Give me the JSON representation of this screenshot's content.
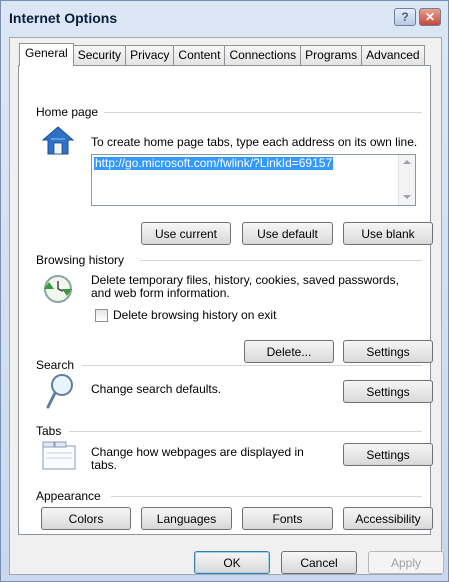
{
  "window": {
    "title": "Internet Options"
  },
  "tabs": [
    "General",
    "Security",
    "Privacy",
    "Content",
    "Connections",
    "Programs",
    "Advanced"
  ],
  "home_page": {
    "label": "Home page",
    "description": "To create home page tabs, type each address on its own line.",
    "url": "http://go.microsoft.com/fwlink/?LinkId=69157",
    "buttons": {
      "use_current": "Use current",
      "use_default": "Use default",
      "use_blank": "Use blank"
    }
  },
  "browsing_history": {
    "label": "Browsing history",
    "description_line1": "Delete temporary files, history, cookies, saved passwords,",
    "description_line2": "and web form information.",
    "checkbox_label": "Delete browsing history on exit",
    "checkbox_checked": false,
    "buttons": {
      "delete": "Delete...",
      "settings": "Settings"
    }
  },
  "search": {
    "label": "Search",
    "description": "Change search defaults.",
    "settings": "Settings"
  },
  "tabs_section": {
    "label": "Tabs",
    "description_line1": "Change how webpages are displayed in",
    "description_line2": "tabs.",
    "settings": "Settings"
  },
  "appearance": {
    "label": "Appearance",
    "buttons": {
      "colors": "Colors",
      "languages": "Languages",
      "fonts": "Fonts",
      "accessibility": "Accessibility"
    }
  },
  "dialog_buttons": {
    "ok": "OK",
    "cancel": "Cancel",
    "apply": "Apply"
  },
  "icons": {
    "help": "help-icon",
    "close": "close-icon",
    "home": "home-icon",
    "history": "history-icon",
    "search": "magnifier-icon",
    "tabs": "tabs-icon"
  },
  "colors": {
    "title_text": "#0a1e3c",
    "selection": "#3399ff",
    "close_button": "#c8473a"
  }
}
